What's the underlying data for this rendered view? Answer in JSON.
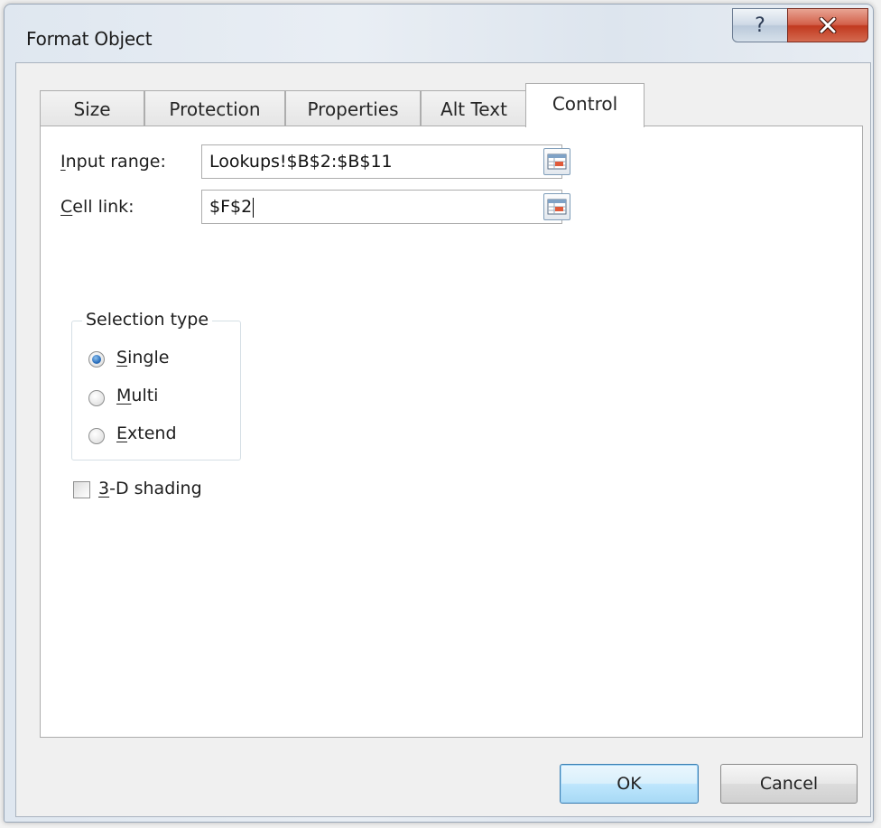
{
  "window": {
    "title": "Format Object",
    "help_glyph": "?",
    "close_glyph": "x"
  },
  "tabs": [
    {
      "label": "Size",
      "active": false
    },
    {
      "label": "Protection",
      "active": false
    },
    {
      "label": "Properties",
      "active": false
    },
    {
      "label": "Alt Text",
      "active": false
    },
    {
      "label": "Control",
      "active": true
    }
  ],
  "control": {
    "input_range": {
      "label_mnemonic": "I",
      "label_rest": "nput range:",
      "value": "Lookups!$B$2:$B$11"
    },
    "cell_link": {
      "label_mnemonic": "C",
      "label_rest": "ell link:",
      "value": "$F$2"
    },
    "selection_type": {
      "title": "Selection type",
      "options": [
        {
          "mnemonic": "S",
          "rest": "ingle",
          "checked": true
        },
        {
          "mnemonic": "M",
          "rest": "ulti",
          "checked": false
        },
        {
          "mnemonic": "E",
          "rest": "xtend",
          "checked": false
        }
      ]
    },
    "shading": {
      "mnemonic": "3",
      "rest": "-D shading",
      "checked": false
    }
  },
  "buttons": {
    "ok": "OK",
    "cancel": "Cancel"
  },
  "colors": {
    "close_button": "#c1391f",
    "default_button": "#bee6fd",
    "radio_selected": "#2a6fbd"
  }
}
